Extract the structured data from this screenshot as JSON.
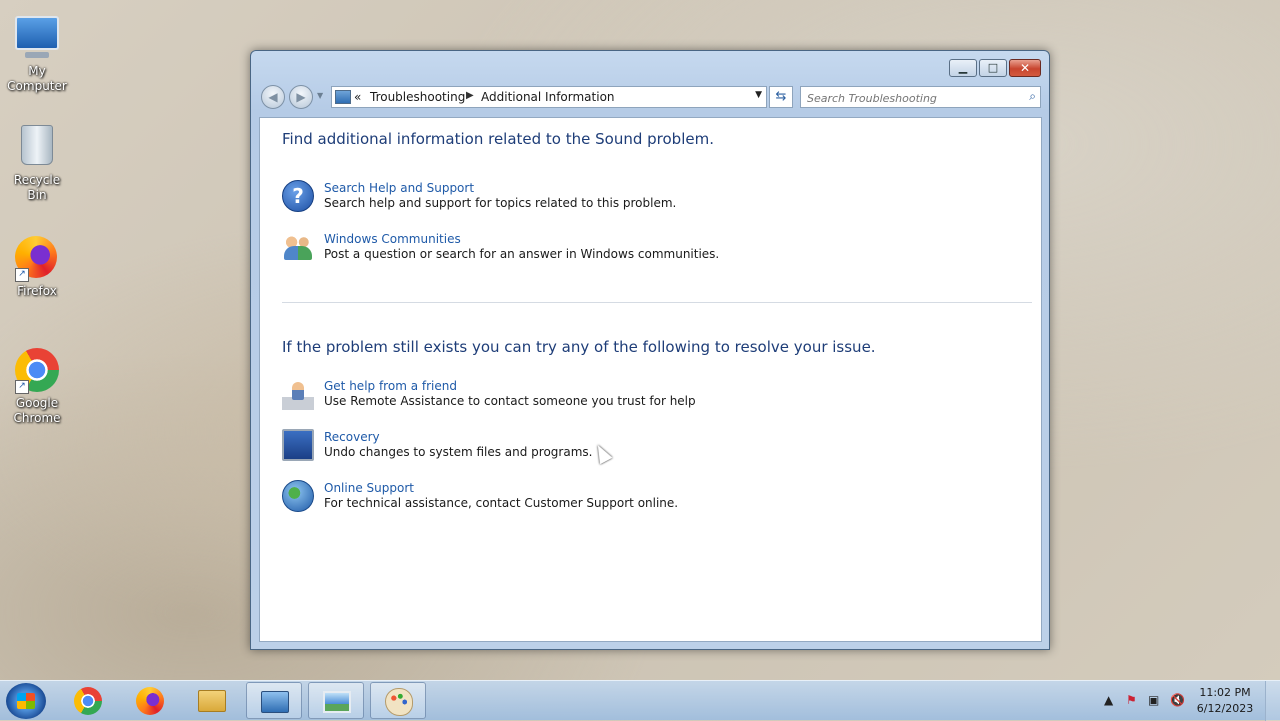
{
  "desktop": {
    "icons": [
      {
        "label_line1": "My",
        "label_line2": "Computer"
      },
      {
        "label_line1": "Recycle Bin",
        "label_line2": ""
      },
      {
        "label_line1": "Firefox",
        "label_line2": ""
      },
      {
        "label_line1": "Google",
        "label_line2": "Chrome"
      }
    ]
  },
  "window": {
    "address": {
      "overflow": "«",
      "crumbs": [
        "Troubleshooting",
        "Additional Information"
      ]
    },
    "search": {
      "placeholder": "Search Troubleshooting"
    },
    "section1": {
      "heading": "Find additional information related to the Sound problem.",
      "tasks": [
        {
          "link": "Search Help and Support",
          "desc": "Search help and support for topics related to this problem.",
          "icon": "help-icon"
        },
        {
          "link": "Windows Communities",
          "desc": "Post a question or search for an answer in Windows communities.",
          "icon": "people-icon"
        }
      ]
    },
    "section2": {
      "heading": "If the problem still exists you can try any of the following to resolve your issue.",
      "tasks": [
        {
          "link": "Get help from a friend",
          "desc": "Use Remote Assistance to contact someone you trust for help",
          "icon": "remote-assistance-icon"
        },
        {
          "link": "Recovery",
          "desc": "Undo changes to system files and programs.",
          "icon": "recovery-icon"
        },
        {
          "link": "Online Support",
          "desc": "For technical assistance, contact Customer Support online.",
          "icon": "globe-icon"
        }
      ]
    }
  },
  "taskbar": {
    "clock": {
      "time": "11:02 PM",
      "date": "6/12/2023"
    }
  }
}
